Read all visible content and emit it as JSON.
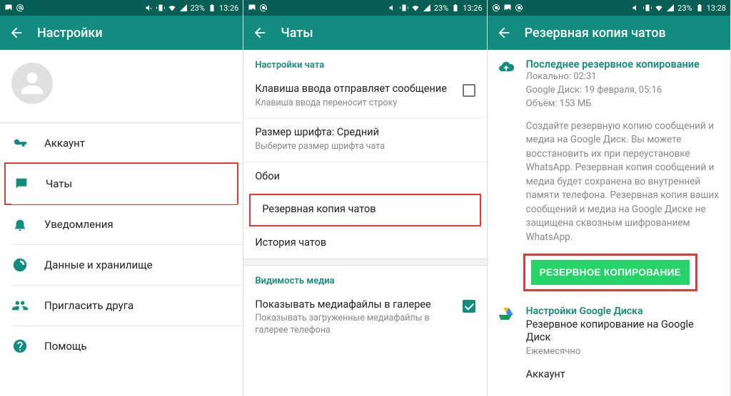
{
  "status": {
    "battery": "23%",
    "time1": "13:26",
    "time2": "13:26",
    "time3": "13:28"
  },
  "screen1": {
    "title": "Настройки",
    "items": {
      "account": "Аккаунт",
      "chats": "Чаты",
      "notifications": "Уведомления",
      "data": "Данные и хранилище",
      "invite": "Пригласить друга",
      "help": "Помощь"
    }
  },
  "screen2": {
    "title": "Чаты",
    "section1": "Настройки чата",
    "enter": {
      "title": "Клавиша ввода отправляет сообщение",
      "sub": "Клавиша ввода переносит строку"
    },
    "font": {
      "title": "Размер шрифта: Средний",
      "sub": "Выберите размер шрифта чата"
    },
    "wallpaper": "Обои",
    "backup": "Резервная копия чатов",
    "history": "История чатов",
    "section2": "Видимость медиа",
    "media": {
      "title": "Показывать медиафайлы в галерее",
      "sub": "Показывать загруженные медиафайлы в галерее телефона"
    }
  },
  "screen3": {
    "title": "Резервная копия чатов",
    "last": "Последнее резервное копирование",
    "local": "Локально: 02:31",
    "gdrive": "Google Диск: 19 февраля, 05:16",
    "size": "Объём: 153 МБ",
    "desc": "Создайте резервную копию сообщений и медиа на Google Диск. Вы можете восстановить их при переустановке WhatsApp. Резервная копия сообщений и медиа будет сохранена во внутренней памяти телефона. Резервная копия ваших сообщений и медиа на Google Диске не защищена сквозным шифрованием WhatsApp.",
    "button": "РЕЗЕРВНОЕ КОПИРОВАНИЕ",
    "gdrive_settings": "Настройки Google Диска",
    "gdrive_backup": "Резервное копирование на Google Диск",
    "freq": "Ежемесячно",
    "account": "Аккаунт"
  }
}
